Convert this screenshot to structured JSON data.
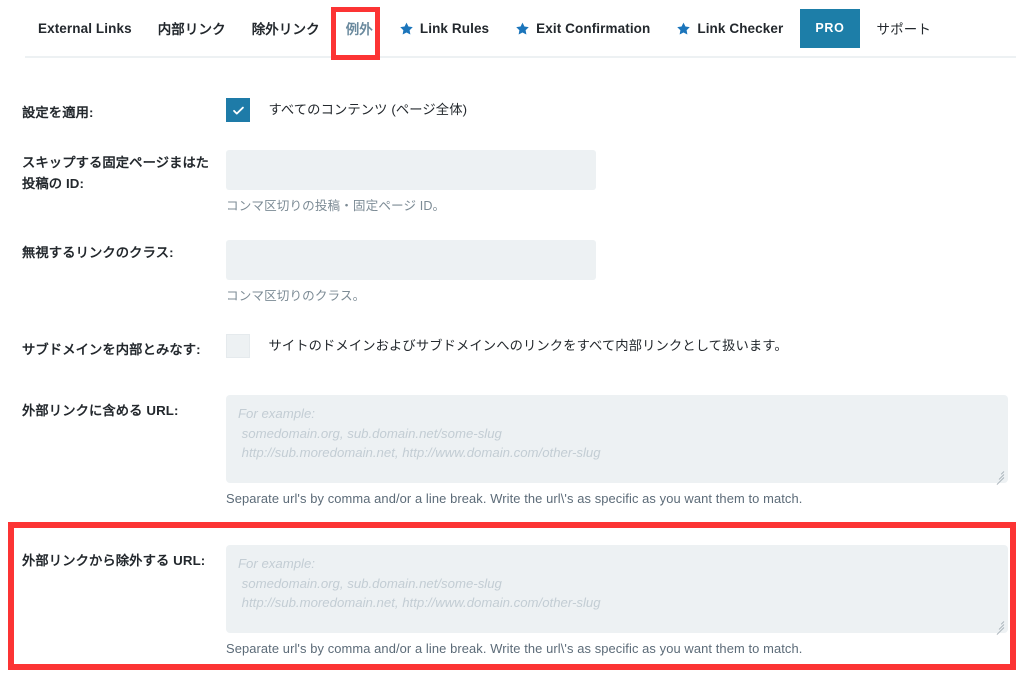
{
  "tabs": [
    {
      "label": "External Links",
      "icon": null,
      "style": "plain",
      "active": false
    },
    {
      "label": "内部リンク",
      "icon": null,
      "style": "plain",
      "active": false
    },
    {
      "label": "除外リンク",
      "icon": null,
      "style": "plain",
      "active": false
    },
    {
      "label": "例外",
      "icon": null,
      "style": "muted",
      "active": true
    },
    {
      "label": "Link Rules",
      "icon": "star-icon",
      "style": "plain",
      "active": false
    },
    {
      "label": "Exit Confirmation",
      "icon": "star-icon",
      "style": "plain",
      "active": false
    },
    {
      "label": "Link Checker",
      "icon": "star-icon",
      "style": "plain",
      "active": false
    },
    {
      "label": "PRO",
      "icon": null,
      "style": "badge",
      "active": false
    },
    {
      "label": "サポート",
      "icon": null,
      "style": "support",
      "active": false
    }
  ],
  "colors": {
    "accent_blue": "#1d7ea8",
    "star_blue": "#1b75bb",
    "highlight_red": "#fc3434",
    "field_bg": "#edf1f3",
    "muted_tab": "#6b8a9e"
  },
  "fields": {
    "apply_settings": {
      "label": "設定を適用:",
      "checkbox_checked": true,
      "checkbox_label": "すべてのコンテンツ (ページ全体)"
    },
    "skip_ids": {
      "label": "スキップする固定ページまはた投稿の ID:",
      "value": "",
      "placeholder": "",
      "helper": "コンマ区切りの投稿・固定ページ ID。"
    },
    "ignore_classes": {
      "label": "無視するリンクのクラス:",
      "value": "",
      "placeholder": "",
      "helper": "コンマ区切りのクラス。"
    },
    "subdomains_internal": {
      "label": "サブドメインを内部とみなす:",
      "checkbox_checked": false,
      "checkbox_label": "サイトのドメインおよびサブドメインへのリンクをすべて内部リンクとして扱います。"
    },
    "include_urls": {
      "label": "外部リンクに含める URL:",
      "value": "",
      "placeholder": "For example:\n somedomain.org, sub.domain.net/some-slug\n http://sub.moredomain.net, http://www.domain.com/other-slug",
      "helper": "Separate url's by comma and/or a line break. Write the url\\'s as specific as you want them to match."
    },
    "exclude_urls": {
      "label": "外部リンクから除外する URL:",
      "value": "",
      "placeholder": "For example:\n somedomain.org, sub.domain.net/some-slug\n http://sub.moredomain.net, http://www.domain.com/other-slug",
      "helper": "Separate url's by comma and/or a line break. Write the url\\'s as specific as you want them to match.",
      "highlighted": true
    }
  },
  "annotations": {
    "tab_highlight_target": "例外",
    "block_highlight_target": "外部リンクから除外する URL:"
  }
}
